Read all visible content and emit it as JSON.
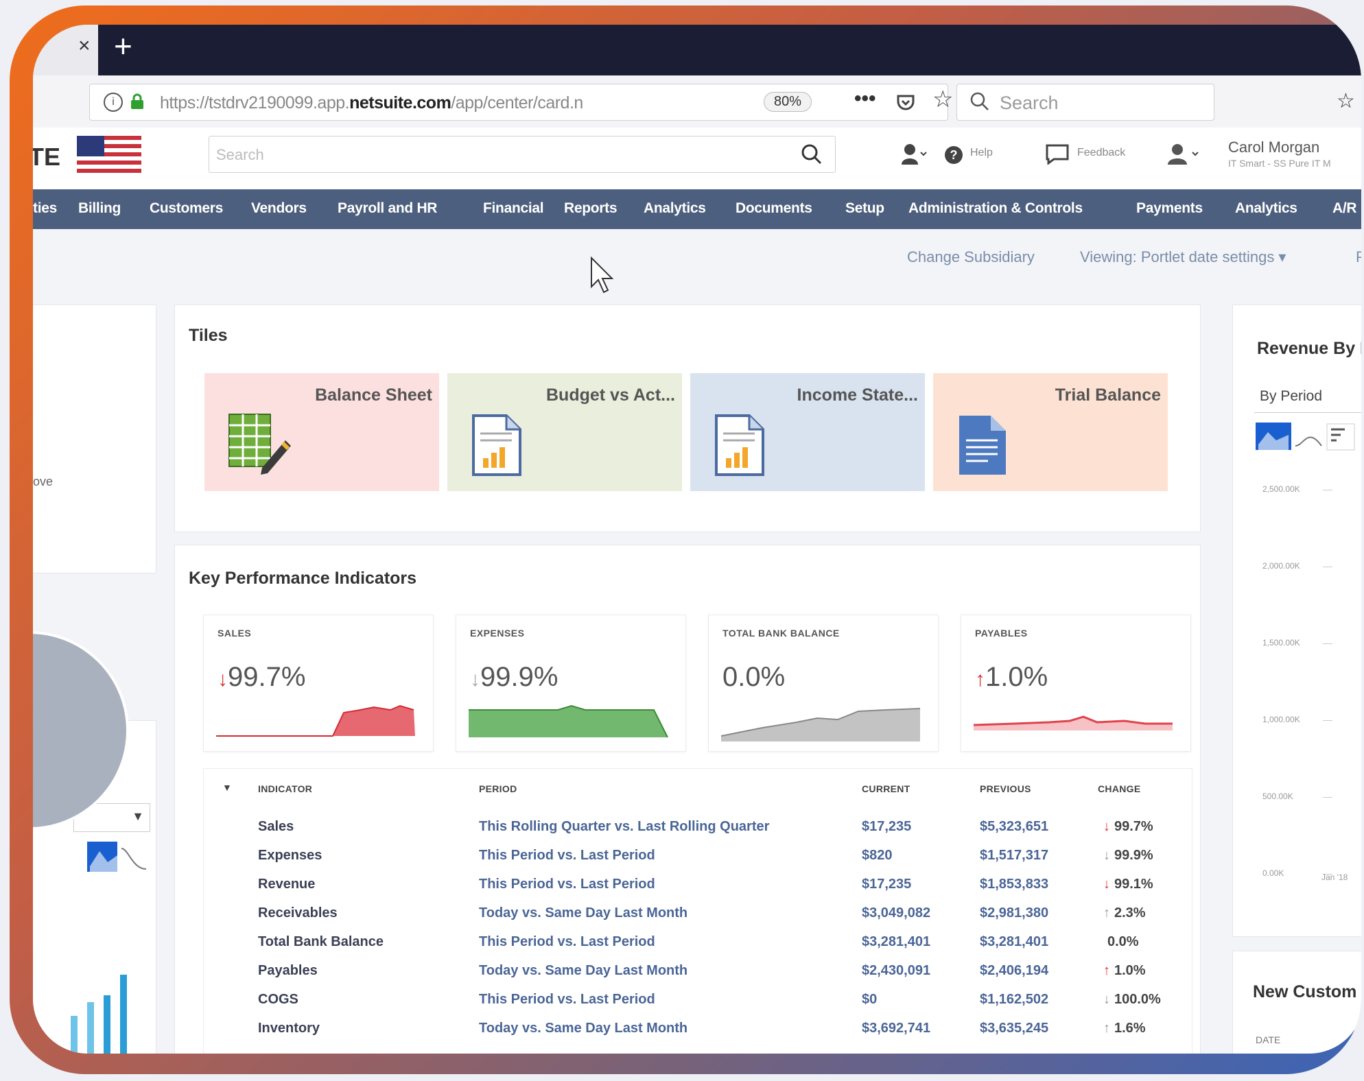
{
  "browser": {
    "tab_close": "×",
    "new_tab": "+",
    "url_prefix": "https://tstdrv2190099.app.",
    "url_domain": "netsuite.com",
    "url_suffix": "/app/center/card.n",
    "zoom": "80%",
    "more": "•••",
    "search_placeholder": "Search"
  },
  "header": {
    "logo_tail": "TE",
    "search_placeholder": "Search",
    "help": "Help",
    "feedback": "Feedback",
    "user_name": "Carol Morgan",
    "user_role": "IT Smart - SS Pure IT M"
  },
  "nav": {
    "items": [
      "ties",
      "Billing",
      "Customers",
      "Vendors",
      "Payroll and HR",
      "Financial",
      "Reports",
      "Analytics",
      "Documents",
      "Setup",
      "Administration & Controls",
      "Payments",
      "Analytics",
      "A/R"
    ]
  },
  "subbar": {
    "change_subsidiary": "Change Subsidiary",
    "viewing": "Viewing: Portlet date settings ▾",
    "more": "P"
  },
  "tiles": {
    "title": "Tiles",
    "items": [
      {
        "label": "Balance Sheet",
        "color": "#fbe0df",
        "icon": "spreadsheet-edit-icon"
      },
      {
        "label": "Budget vs Act...",
        "color": "#eaeedd",
        "icon": "report-chart-icon"
      },
      {
        "label": "Income State...",
        "color": "#d9e2ef",
        "icon": "report-chart-icon"
      },
      {
        "label": "Trial Balance",
        "color": "#fde2d4",
        "icon": "document-icon"
      }
    ]
  },
  "kpi": {
    "title": "Key Performance Indicators",
    "cards": [
      {
        "label": "SALES",
        "value": "99.7%",
        "direction": "down",
        "color": "#e0424c"
      },
      {
        "label": "EXPENSES",
        "value": "99.9%",
        "direction": "down",
        "color": "#5aac56"
      },
      {
        "label": "TOTAL BANK BALANCE",
        "value": "0.0%",
        "direction": "none",
        "color": "#9a9a9a"
      },
      {
        "label": "PAYABLES",
        "value": "1.0%",
        "direction": "up",
        "color": "#e0424c"
      }
    ],
    "table": {
      "headers": [
        "INDICATOR",
        "PERIOD",
        "CURRENT",
        "PREVIOUS",
        "CHANGE"
      ],
      "rows": [
        {
          "indicator": "Sales",
          "period": "This Rolling Quarter vs. Last Rolling Quarter",
          "current": "$17,235",
          "previous": "$5,323,651",
          "arrow": "↓",
          "change": "99.7%"
        },
        {
          "indicator": "Expenses",
          "period": "This Period vs. Last Period",
          "current": "$820",
          "previous": "$1,517,317",
          "arrow": "↓",
          "change": "99.9%"
        },
        {
          "indicator": "Revenue",
          "period": "This Period vs. Last Period",
          "current": "$17,235",
          "previous": "$1,853,833",
          "arrow": "↓",
          "change": "99.1%"
        },
        {
          "indicator": "Receivables",
          "period": "Today vs. Same Day Last Month",
          "current": "$3,049,082",
          "previous": "$2,981,380",
          "arrow": "↑",
          "change": "2.3%"
        },
        {
          "indicator": "Total Bank Balance",
          "period": "This Period vs. Last Period",
          "current": "$3,281,401",
          "previous": "$3,281,401",
          "arrow": "",
          "change": "0.0%"
        },
        {
          "indicator": "Payables",
          "period": "Today vs. Same Day Last Month",
          "current": "$2,430,091",
          "previous": "$2,406,194",
          "arrow": "↑",
          "change": "1.0%"
        },
        {
          "indicator": "COGS",
          "period": "This Period vs. Last Period",
          "current": "$0",
          "previous": "$1,162,502",
          "arrow": "↓",
          "change": "100.0%"
        },
        {
          "indicator": "Inventory",
          "period": "Today vs. Same Day Last Month",
          "current": "$3,692,741",
          "previous": "$3,635,245",
          "arrow": "↑",
          "change": "1.6%"
        }
      ]
    }
  },
  "revenue": {
    "title": "Revenue By P",
    "select": "By Period",
    "yticks": [
      "2,500.00K",
      "2,000.00K",
      "1,500.00K",
      "1,000.00K",
      "500.00K",
      "0.00K"
    ],
    "xtick": "Jan '18"
  },
  "new_customers": {
    "title": "New Custom",
    "date_label": "DATE"
  },
  "left": {
    "partial_text": "ove"
  }
}
